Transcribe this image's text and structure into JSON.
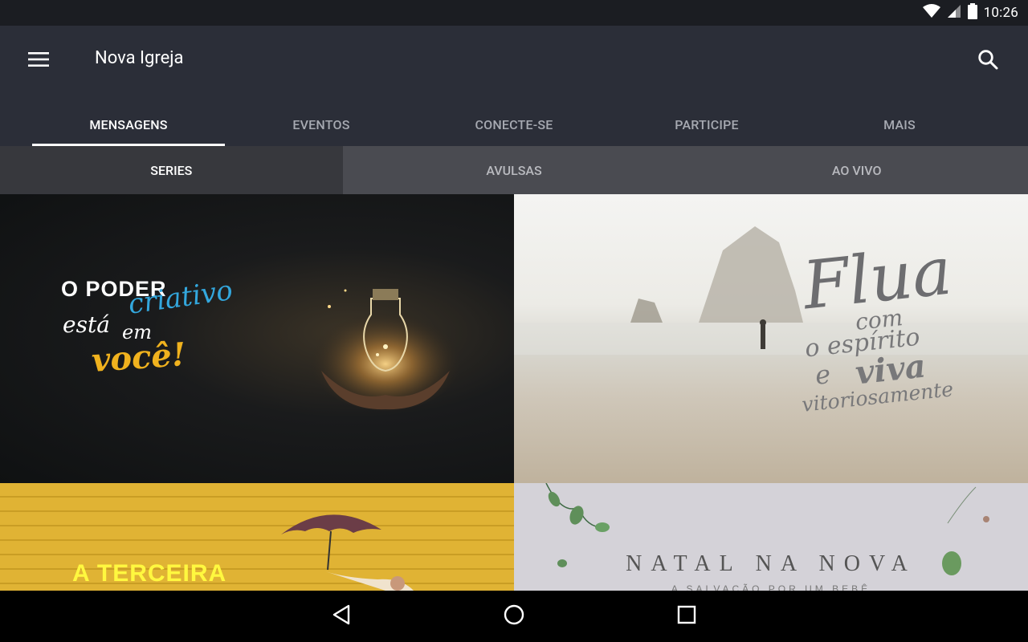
{
  "status_bar": {
    "time": "10:26",
    "icons": [
      "wifi-icon",
      "signal-icon",
      "battery-icon"
    ]
  },
  "app_bar": {
    "title": "Nova Igreja",
    "menu_icon": "menu-icon",
    "search_icon": "search-icon"
  },
  "tabs": [
    {
      "label": "MENSAGENS",
      "active": true
    },
    {
      "label": "EVENTOS",
      "active": false
    },
    {
      "label": "CONECTE-SE",
      "active": false
    },
    {
      "label": "PARTICIPE",
      "active": false
    },
    {
      "label": "MAIS",
      "active": false
    }
  ],
  "subtabs": [
    {
      "label": "SERIES",
      "active": true
    },
    {
      "label": "AVULSAS",
      "active": false
    },
    {
      "label": "AO VIVO",
      "active": false
    }
  ],
  "series": [
    {
      "line1": "O PODER",
      "line1_script": "criativo",
      "line2": "está",
      "line2b": "em",
      "line3": "você!"
    },
    {
      "title_big": "Flua",
      "line_com": "com",
      "line_espirito": "o espírito",
      "line_e": "e",
      "line_viva": "viva",
      "line_vitoriosamente": "vitoriosamente"
    },
    {
      "text": "A TERCEIRA"
    },
    {
      "text": "NATAL NA NOVA",
      "subtitle": "A SALVAÇÃO POR UM BEBÊ"
    }
  ],
  "colors": {
    "app_bar": "#2b2e38",
    "status_bar": "#1b1d22",
    "subtab_bg": "#4a4b51",
    "subtab_active": "#37383d",
    "accent_blue": "#33a7dd",
    "accent_gold": "#f0b21e"
  },
  "nav": {
    "back_icon": "back-icon",
    "home_icon": "home-icon",
    "recents_icon": "recents-icon"
  }
}
